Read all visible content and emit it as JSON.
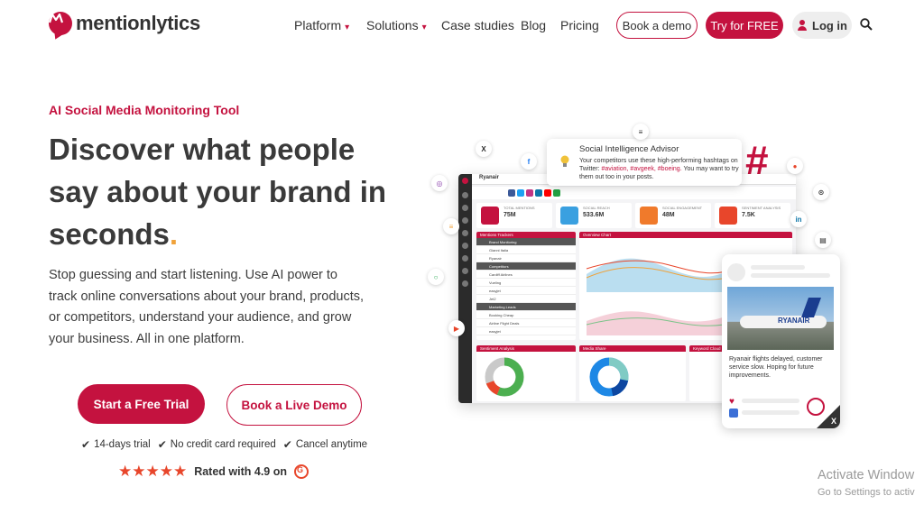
{
  "brand": {
    "name": "mentionlytics",
    "accent": "#c4123f"
  },
  "nav": {
    "items": [
      {
        "label": "Platform",
        "has_dropdown": true
      },
      {
        "label": "Solutions",
        "has_dropdown": true
      },
      {
        "label": "Case studies",
        "has_dropdown": false
      },
      {
        "label": "Blog",
        "has_dropdown": false
      },
      {
        "label": "Pricing",
        "has_dropdown": false
      }
    ],
    "book_demo": "Book a demo",
    "try_free": "Try for FREE",
    "login": "Log in",
    "caret": "▾",
    "search_icon": "search-icon"
  },
  "hero": {
    "eyebrow": "AI Social Media Monitoring Tool",
    "headline": "Discover what people say about your brand in seconds",
    "headline_dot": ".",
    "description": "Stop guessing and start listening. Use AI power to track online conversations about your brand, products, or competitors, understand your audience, and grow your business. All in one platform.",
    "cta_primary": "Start a Free Trial",
    "cta_secondary": "Book a Live Demo",
    "perks": [
      "14-days trial",
      "No credit card required",
      "Cancel anytime"
    ],
    "check_glyph": "✔",
    "rating": {
      "stars": 5,
      "star_glyphs": "★★★★★",
      "text": "Rated with 4.9 on",
      "platform_icon": "g2-icon",
      "platform_letter": "G"
    }
  },
  "illustration": {
    "dashboard": {
      "brand": "Ryanair",
      "stats": [
        {
          "label": "TOTAL MENTIONS",
          "value": "75M",
          "color": "#c4123f"
        },
        {
          "label": "SOCIAL REACH",
          "value": "533.6M",
          "color": "#3aa0e0"
        },
        {
          "label": "SOCIAL ENGAGEMENT",
          "value": "48M",
          "color": "#f07a2b"
        },
        {
          "label": "SENTIMENT ANALYSIS",
          "value": "7.5K",
          "color": "#e8462b"
        }
      ],
      "panels": {
        "trackers": "Mentions Trackers",
        "overview": "Overview Chart",
        "sentiment": "Sentiment Analysis",
        "media": "Media Share",
        "keyword": "Keyword Cloud"
      },
      "tracker_rows": [
        "Brand Monitoring",
        "Gianni Italia",
        "Ryanair",
        "Competitors",
        "Cardiff Airlines",
        "Vueling",
        "easyjet",
        "Jet2",
        "Marketing Leads",
        "Booking Cheap",
        "Airline Flight Deals",
        "easyjet"
      ]
    },
    "advisor": {
      "title": "Social Intelligence Advisor",
      "body_pre": "Your competitors use these high-performing hashtags on Twitter: ",
      "tags": "#aviation, #avgeek, #boeing.",
      "body_post": " You may want to try them out too in your posts."
    },
    "social_card": {
      "plane_name": "RYANAIR",
      "text": "Ryanair flights delayed, customer service slow. Hoping for future improvements.",
      "platform": "X"
    }
  },
  "system_watermark": {
    "title": "Activate Window",
    "subtitle": "Go to Settings to activ"
  }
}
